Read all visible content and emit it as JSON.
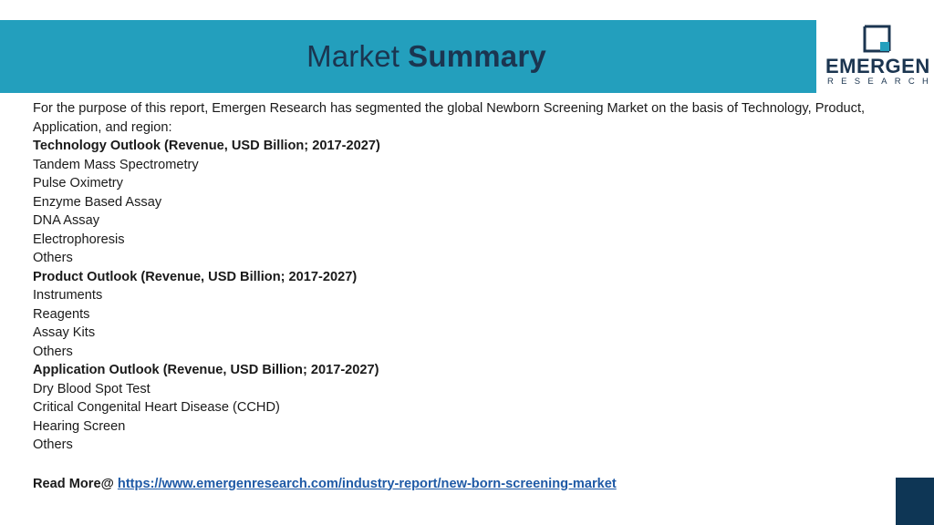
{
  "header": {
    "title_light": "Market",
    "title_bold": "Summary"
  },
  "logo": {
    "name": "EMERGEN",
    "sub": "RESEARCH"
  },
  "body": {
    "intro": "For the purpose of this report, Emergen Research has segmented the global Newborn Screening Market on the basis of Technology, Product, Application, and region:",
    "sections": [
      {
        "heading": "Technology Outlook (Revenue, USD Billion; 2017-2027)",
        "items": [
          "Tandem Mass Spectrometry",
          "Pulse Oximetry",
          "Enzyme Based Assay",
          "DNA Assay",
          "Electrophoresis",
          "Others"
        ]
      },
      {
        "heading": "Product Outlook (Revenue, USD Billion; 2017-2027)",
        "items": [
          "Instruments",
          "Reagents",
          "Assay Kits",
          "Others"
        ]
      },
      {
        "heading": "Application Outlook (Revenue, USD Billion; 2017-2027)",
        "items": [
          "Dry Blood Spot Test",
          "Critical Congenital Heart Disease (CCHD)",
          "Hearing Screen",
          "Others"
        ]
      }
    ],
    "read_more_label": "Read More@",
    "read_more_link": "https://www.emergenresearch.com/industry-report/new-born-screening-market"
  },
  "colors": {
    "header_band": "#239fbd",
    "title_text": "#1b3550",
    "link": "#1f5aa6",
    "corner_block": "#0e3655"
  }
}
